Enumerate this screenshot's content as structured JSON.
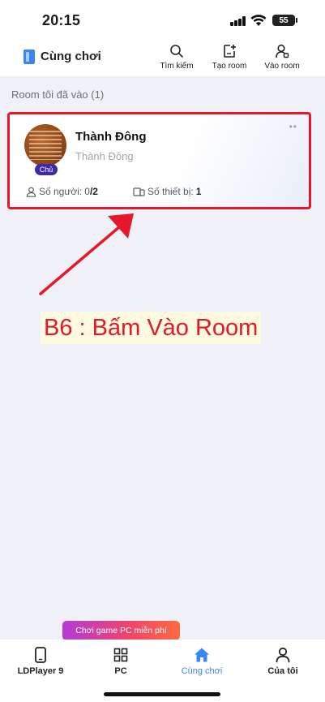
{
  "status_bar": {
    "time": "20:15",
    "battery": "55"
  },
  "header": {
    "title": "Cùng chơi",
    "actions": [
      {
        "label": "Tìm kiếm",
        "icon": "search-icon"
      },
      {
        "label": "Tạo room",
        "icon": "create-room-icon"
      },
      {
        "label": "Vào room",
        "icon": "join-room-icon"
      }
    ]
  },
  "section": {
    "title": "Room tôi đã vào (1)"
  },
  "room": {
    "name": "Thành Đông",
    "owner": "Thành Đông",
    "owner_badge": "Chủ",
    "members_label": "Số người:",
    "members_current": "0",
    "members_max": "/2",
    "devices_label": "Số thiết bị:",
    "devices_value": "1"
  },
  "annotation": {
    "text": "B6 : Bấm Vào Room",
    "color": "#e4182a"
  },
  "promo": {
    "text": "Chơi game PC miễn phí"
  },
  "bottom_nav": [
    {
      "label": "LDPlayer 9",
      "icon": "phone-icon"
    },
    {
      "label": "PC",
      "icon": "grid-icon"
    },
    {
      "label": "Cùng chơi",
      "icon": "home-icon",
      "active": true
    },
    {
      "label": "Của tôi",
      "icon": "person-icon"
    }
  ],
  "colors": {
    "accent": "#3a85f0",
    "highlight": "#e4182a",
    "background": "#eff1f6"
  }
}
